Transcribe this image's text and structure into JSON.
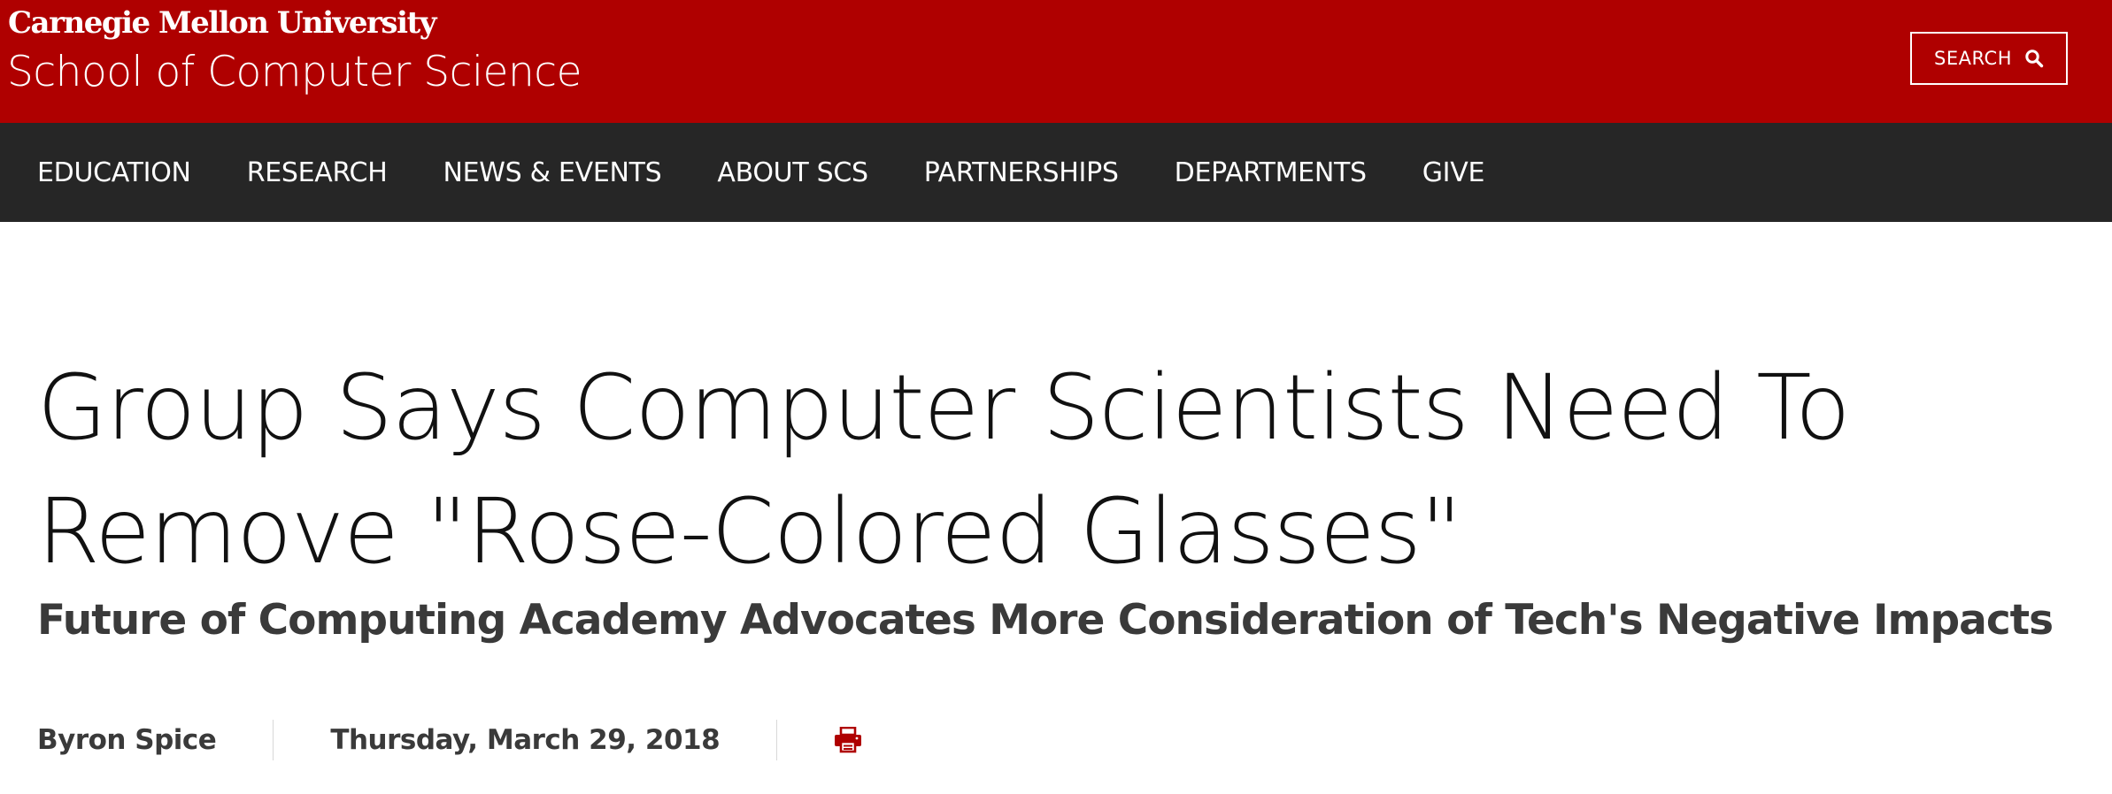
{
  "header": {
    "university": "Carnegie Mellon University",
    "school": "School of Computer Science",
    "search_label": "SEARCH",
    "search_icon": "search-icon",
    "brand_color": "#af0000"
  },
  "nav": {
    "background": "#262626",
    "items": [
      {
        "label": "EDUCATION"
      },
      {
        "label": "RESEARCH"
      },
      {
        "label": "NEWS & EVENTS"
      },
      {
        "label": "ABOUT SCS"
      },
      {
        "label": "PARTNERSHIPS"
      },
      {
        "label": "DEPARTMENTS"
      },
      {
        "label": "GIVE"
      }
    ]
  },
  "article": {
    "title_line1": "Group Says Computer Scientists Need To",
    "title_line2": "Remove \"Rose-Colored Glasses\"",
    "subtitle": "Future of Computing Academy Advocates More Consideration of Tech's Negative Impacts",
    "author": "Byron Spice",
    "date": "Thursday, March 29, 2018",
    "print_icon": "print-icon",
    "print_icon_color": "#af0000"
  }
}
